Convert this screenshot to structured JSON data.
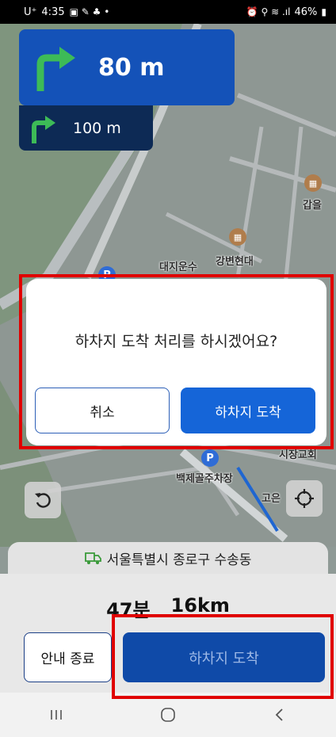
{
  "status": {
    "carrier": "U⁺",
    "time": "4:35",
    "battery": "46%"
  },
  "navigation": {
    "turn_main_distance": "80 m",
    "turn_next_distance": "100 m"
  },
  "map": {
    "labels": {
      "label_1": "갑을",
      "label_2": "대지운수",
      "label_3": "강변현대",
      "label_4": "백제골주차장",
      "label_5": "고은",
      "label_6": "시장교회"
    }
  },
  "dialog": {
    "message": "하차지 도착 처리를 하시겠어요?",
    "cancel_label": "취소",
    "confirm_label": "하차지 도착"
  },
  "destination": {
    "address": "서울특별시 종로구 수송동"
  },
  "eta": {
    "time": "47분",
    "distance": "16km"
  },
  "actions": {
    "end_label": "안내 종료",
    "arrive_label": "하차지 도착"
  },
  "colors": {
    "turn_main_bg": "#1452b8",
    "turn_next_bg": "#0d2a55",
    "primary_button": "#1565d8",
    "highlight": "#e00000",
    "turn_arrow": "#3dbb57"
  },
  "icons": {
    "rotate": "rotate-icon",
    "locate": "crosshair-icon",
    "truck": "truck-icon"
  }
}
